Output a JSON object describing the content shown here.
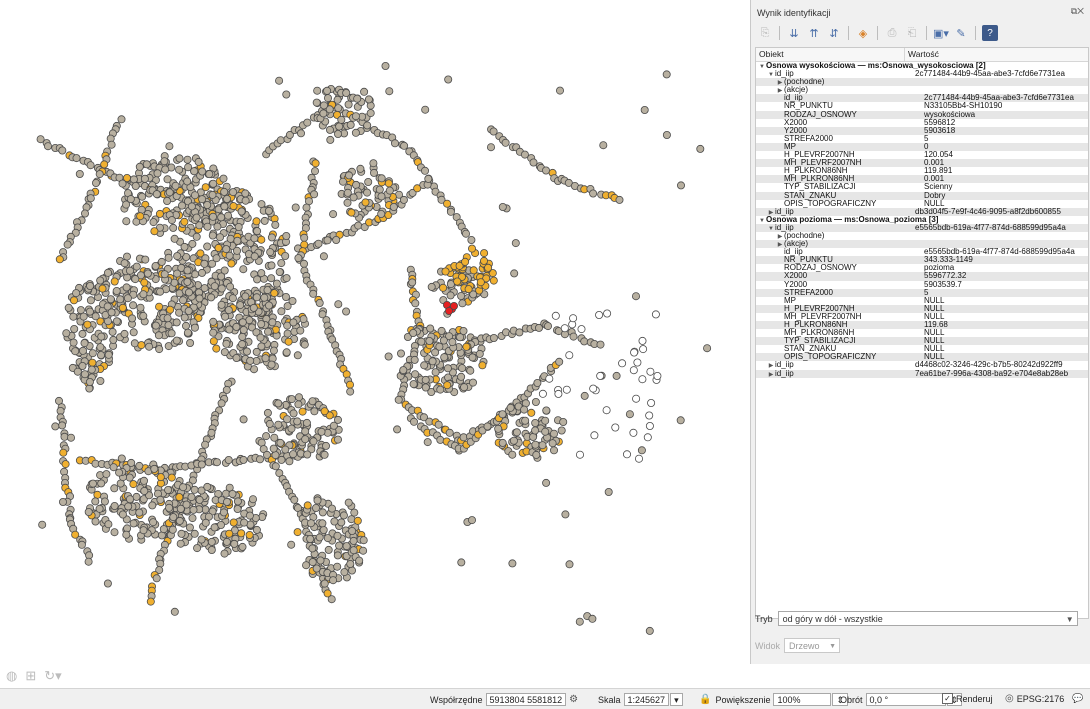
{
  "panel": {
    "title": "Wynik identyfikacji",
    "columns": {
      "object": "Obiekt",
      "value": "Wartość"
    },
    "rows": [
      {
        "l": 0,
        "a": "▼",
        "k": "Osnowa wysokościowa — ms:Osnowa_wysokosciowa  [2]",
        "v": "",
        "g": true
      },
      {
        "l": 1,
        "a": "▼",
        "k": "id_iip",
        "v": "2c771484-44b9-45aa-abe3-7cfd6e7731ea"
      },
      {
        "l": 2,
        "a": "▶",
        "k": "(pochodne)",
        "v": ""
      },
      {
        "l": 2,
        "a": "▶",
        "k": "(akcje)",
        "v": ""
      },
      {
        "l": 2,
        "a": "",
        "k": "id_iip",
        "v": "2c771484-44b9-45aa-abe3-7cfd6e7731ea"
      },
      {
        "l": 2,
        "a": "",
        "k": "NR_PUNKTU",
        "v": "N33105Bb4-SH10190"
      },
      {
        "l": 2,
        "a": "",
        "k": "RODZAJ_OSNOWY",
        "v": "wysokościowa"
      },
      {
        "l": 2,
        "a": "",
        "k": "X2000",
        "v": "5596812"
      },
      {
        "l": 2,
        "a": "",
        "k": "Y2000",
        "v": "5903618"
      },
      {
        "l": 2,
        "a": "",
        "k": "STREFA2000",
        "v": "5"
      },
      {
        "l": 2,
        "a": "",
        "k": "MP",
        "v": "0"
      },
      {
        "l": 2,
        "a": "",
        "k": "H_PLEVRF2007NH",
        "v": "120.054"
      },
      {
        "l": 2,
        "a": "",
        "k": "MH_PLEVRF2007NH",
        "v": "0.001"
      },
      {
        "l": 2,
        "a": "",
        "k": "H_PLKRON86NH",
        "v": "119.891"
      },
      {
        "l": 2,
        "a": "",
        "k": "MH_PLKRON86NH",
        "v": "0.001"
      },
      {
        "l": 2,
        "a": "",
        "k": "TYP_STABILIZACJI",
        "v": "Ścienny"
      },
      {
        "l": 2,
        "a": "",
        "k": "STAN_ZNAKU",
        "v": "Dobry"
      },
      {
        "l": 2,
        "a": "",
        "k": "OPIS_TOPOGRAFICZNY",
        "v": "NULL"
      },
      {
        "l": 1,
        "a": "▶",
        "k": "id_iip",
        "v": "db3d04f5-7e9f-4c46-9095-a8f2db600855"
      },
      {
        "l": 0,
        "a": "▼",
        "k": "Osnowa pozioma — ms:Osnowa_pozioma  [3]",
        "v": "",
        "g": true
      },
      {
        "l": 1,
        "a": "▼",
        "k": "id_iip",
        "v": "e5565bdb-619a-4f77-874d-688599d95a4a"
      },
      {
        "l": 2,
        "a": "▶",
        "k": "(pochodne)",
        "v": ""
      },
      {
        "l": 2,
        "a": "▶",
        "k": "(akcje)",
        "v": ""
      },
      {
        "l": 2,
        "a": "",
        "k": "id_iip",
        "v": "e5565bdb-619a-4f77-874d-688599d95a4a"
      },
      {
        "l": 2,
        "a": "",
        "k": "NR_PUNKTU",
        "v": "343.333-1149"
      },
      {
        "l": 2,
        "a": "",
        "k": "RODZAJ_OSNOWY",
        "v": "pozioma"
      },
      {
        "l": 2,
        "a": "",
        "k": "X2000",
        "v": "5596772.32"
      },
      {
        "l": 2,
        "a": "",
        "k": "Y2000",
        "v": "5903539.7"
      },
      {
        "l": 2,
        "a": "",
        "k": "STREFA2000",
        "v": "5"
      },
      {
        "l": 2,
        "a": "",
        "k": "MP",
        "v": "NULL"
      },
      {
        "l": 2,
        "a": "",
        "k": "H_PLEVRF2007NH",
        "v": "NULL"
      },
      {
        "l": 2,
        "a": "",
        "k": "MH_PLEVRF2007NH",
        "v": "NULL"
      },
      {
        "l": 2,
        "a": "",
        "k": "H_PLKRON86NH",
        "v": "119.68"
      },
      {
        "l": 2,
        "a": "",
        "k": "MH_PLKRON86NH",
        "v": "NULL"
      },
      {
        "l": 2,
        "a": "",
        "k": "TYP_STABILIZACJI",
        "v": "NULL"
      },
      {
        "l": 2,
        "a": "",
        "k": "STAN_ZNAKU",
        "v": "NULL"
      },
      {
        "l": 2,
        "a": "",
        "k": "OPIS_TOPOGRAFICZNY",
        "v": "NULL"
      },
      {
        "l": 1,
        "a": "▶",
        "k": "id_iip",
        "v": "d4468c02-3246-429c-b7b5-80242d922ff9"
      },
      {
        "l": 1,
        "a": "▶",
        "k": "id_iip",
        "v": "7ea61be7-996a-4308-ba92-e704e8ab28eb"
      }
    ],
    "mode_label": "Tryb",
    "mode_value": "od góry w dół - wszystkie",
    "view_label": "Widok",
    "view_value": "Drzewo"
  },
  "status": {
    "coord_label": "Współrzędne",
    "coord_value": "5913804  5581812",
    "scale_label": "Skala",
    "scale_value": "1:245627",
    "magnifier_label": "Powiększenie",
    "magnifier_value": "100%",
    "rotation_label": "Obrót",
    "rotation_value": "0,0 °",
    "render_label": "Renderuj",
    "render_checked": true,
    "crs": "EPSG:2176"
  },
  "map": {
    "point_color": "#b8b0a0",
    "point_stroke": "#4a4a4a",
    "highlight_color": "#f0b030",
    "selected_color": "#e52020"
  }
}
